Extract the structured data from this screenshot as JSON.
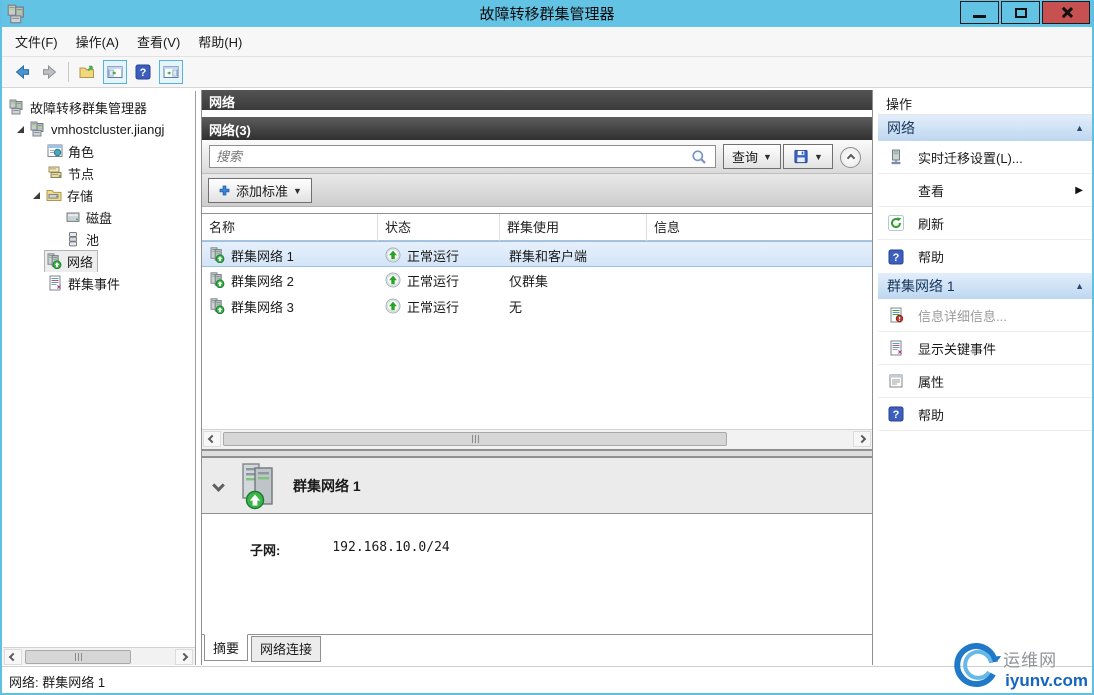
{
  "titlebar": {
    "title": "故障转移群集管理器"
  },
  "menubar": {
    "items": [
      {
        "label": "文件(F)"
      },
      {
        "label": "操作(A)"
      },
      {
        "label": "查看(V)"
      },
      {
        "label": "帮助(H)"
      }
    ]
  },
  "tree": {
    "root_label": "故障转移群集管理器",
    "cluster_label": "vmhostcluster.jiangj",
    "items": {
      "roles": "角色",
      "nodes": "节点",
      "storage": "存储",
      "disks": "磁盘",
      "pools": "池",
      "networks": "网络",
      "events": "群集事件"
    }
  },
  "main": {
    "panel_title": "网络",
    "list_title": "网络(3)",
    "search": {
      "placeholder": "搜索"
    },
    "query_button": "查询",
    "add_criteria_button": "添加标准",
    "table": {
      "columns": [
        "名称",
        "状态",
        "群集使用",
        "信息"
      ],
      "rows": [
        {
          "name": "群集网络 1",
          "status": "正常运行",
          "cluster_use": "群集和客户端",
          "info": ""
        },
        {
          "name": "群集网络 2",
          "status": "正常运行",
          "cluster_use": "仅群集",
          "info": ""
        },
        {
          "name": "群集网络 3",
          "status": "正常运行",
          "cluster_use": "无",
          "info": ""
        }
      ]
    },
    "detail": {
      "title": "群集网络 1",
      "subnet_label": "子网:",
      "subnet_value": "192.168.10.0/24"
    },
    "tabs": [
      {
        "label": "摘要"
      },
      {
        "label": "网络连接"
      }
    ]
  },
  "actions": {
    "title": "操作",
    "sections": [
      {
        "header": "网络",
        "items": [
          {
            "label": "实时迁移设置(L)..."
          },
          {
            "label": "查看"
          },
          {
            "label": "刷新"
          },
          {
            "label": "帮助"
          }
        ]
      },
      {
        "header": "群集网络 1",
        "items": [
          {
            "label": "信息详细信息..."
          },
          {
            "label": "显示关键事件"
          },
          {
            "label": "属性"
          },
          {
            "label": "帮助"
          }
        ]
      }
    ]
  },
  "statusbar": {
    "text": "网络: 群集网络 1"
  },
  "watermark": {
    "name": "运维网",
    "domain": "iyunv.com"
  },
  "glyphs": {
    "dropdown": "▼",
    "section_collapse": "▲",
    "submenu": "▶",
    "help": "?"
  },
  "icons": {
    "app": "server-cluster",
    "back": "arrow-left",
    "forward": "arrow-right",
    "export": "folder-with-arrow",
    "console_tree_toggle": "window-left-pane",
    "help": "question-mark-square",
    "action_pane_toggle": "window-right-pane",
    "search": "magnifier",
    "save": "floppy-disk",
    "collapse": "chevron-up-circle",
    "add": "blue-plus",
    "status_up": "green-up-arrow-circle",
    "refresh": "green-circular-arrow",
    "network": "server-with-green-up-badge",
    "roles": "application-window",
    "nodes": "server-stack",
    "storage": "folder-drive",
    "disk": "hard-disk",
    "pool": "disk-cylinder",
    "events": "event-log-document",
    "live_migration": "server-tower",
    "info_details": "document-red-badge",
    "critical_events": "event-log-document",
    "properties": "properties-window"
  },
  "colors": {
    "titlebar": "#63c3e4",
    "close_button": "#c75050",
    "dark_header": "#3f3f3f",
    "selection_fill": "#d6e6f8",
    "selection_border": "#9cbfe2",
    "action_header_top": "#e3eefb",
    "action_header_bottom": "#bdd7f0",
    "status_green": "#27a427",
    "link_blue": "#1565c0"
  }
}
